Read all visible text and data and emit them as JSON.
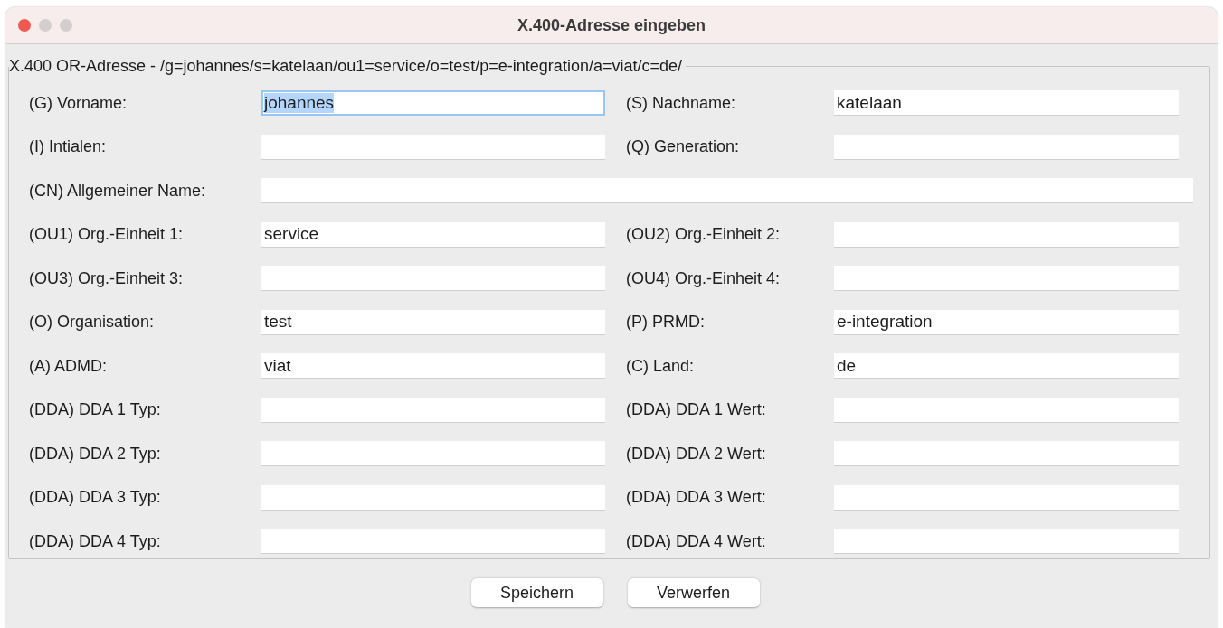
{
  "window": {
    "title": "X.400-Adresse eingeben"
  },
  "group": {
    "legend": "X.400 OR-Adresse - /g=johannes/s=katelaan/ou1=service/o=test/p=e-integration/a=viat/c=de/"
  },
  "rows": [
    {
      "fields": [
        {
          "label": "(G) Vorname:",
          "value": "johannes",
          "focused": true
        },
        {
          "label": "(S) Nachname:",
          "value": "katelaan",
          "focused": false
        }
      ]
    },
    {
      "fields": [
        {
          "label": "(I) Intialen:",
          "focused": false
        },
        {
          "label": "(Q) Generation:",
          "focused": false
        }
      ]
    },
    {
      "fields": [
        {
          "label": "(CN) Allgemeiner Name:",
          "focused": false
        }
      ]
    },
    {
      "fields": [
        {
          "label": "(OU1) Org.-Einheit 1:",
          "value": "service",
          "focused": false
        },
        {
          "label": "(OU2) Org.-Einheit 2:",
          "focused": false
        }
      ]
    },
    {
      "fields": [
        {
          "label": "(OU3) Org.-Einheit 3:",
          "focused": false
        },
        {
          "label": "(OU4) Org.-Einheit 4:",
          "focused": false
        }
      ]
    },
    {
      "fields": [
        {
          "label": "(O) Organisation:",
          "value": "test",
          "focused": false
        },
        {
          "label": "(P) PRMD:",
          "value": "e-integration",
          "focused": false
        }
      ]
    },
    {
      "fields": [
        {
          "label": "(A) ADMD:",
          "value": "viat",
          "focused": false
        },
        {
          "label": "(C) Land:",
          "value": "de",
          "focused": false
        }
      ]
    },
    {
      "fields": [
        {
          "label": "(DDA) DDA 1 Typ:",
          "focused": false
        },
        {
          "label": "(DDA) DDA 1 Wert:",
          "focused": false
        }
      ]
    },
    {
      "fields": [
        {
          "label": "(DDA) DDA 2 Typ:",
          "focused": false
        },
        {
          "label": "(DDA) DDA 2 Wert:",
          "focused": false
        }
      ]
    },
    {
      "fields": [
        {
          "label": "(DDA) DDA 3 Typ:",
          "focused": false
        },
        {
          "label": "(DDA) DDA 3 Wert:",
          "focused": false
        }
      ]
    },
    {
      "fields": [
        {
          "label": "(DDA) DDA 4 Typ:",
          "focused": false
        },
        {
          "label": "(DDA) DDA 4 Wert:",
          "focused": false
        }
      ]
    }
  ],
  "buttons": [
    "Speichern",
    "Verwerfen"
  ]
}
